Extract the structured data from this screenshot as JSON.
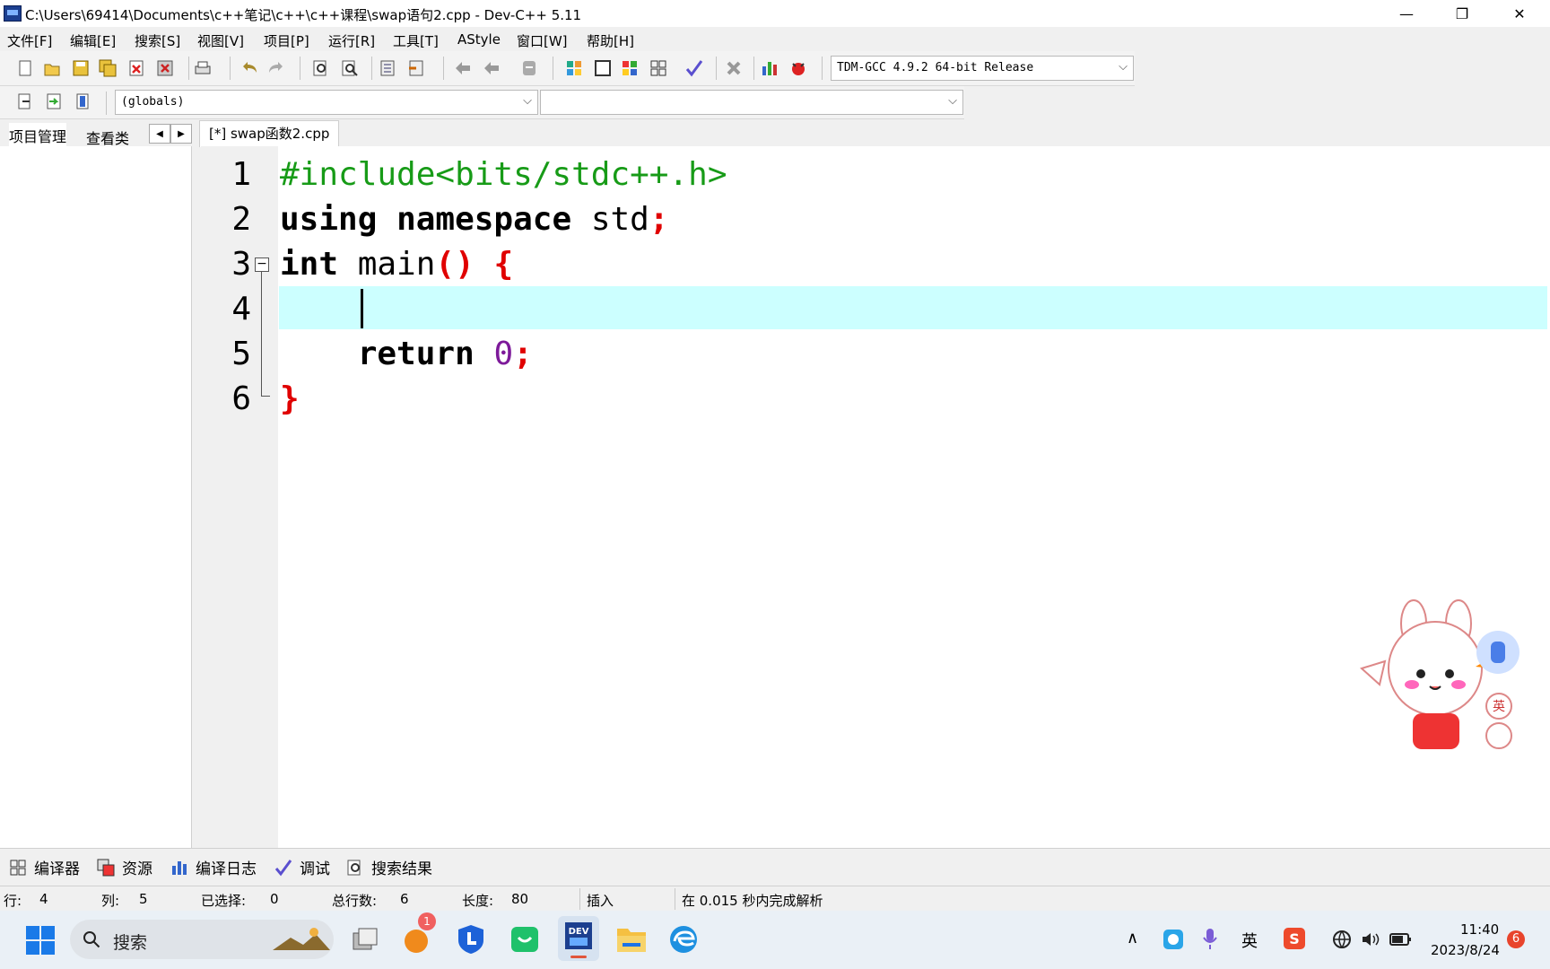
{
  "window": {
    "title": "C:\\Users\\69414\\Documents\\c++笔记\\c++\\c++课程\\swap语句2.cpp - Dev-C++ 5.11",
    "minimize": "—",
    "maximize": "❐",
    "close": "✕"
  },
  "menu": [
    "文件[F]",
    "编辑[E]",
    "搜索[S]",
    "视图[V]",
    "项目[P]",
    "运行[R]",
    "工具[T]",
    "AStyle",
    "窗口[W]",
    "帮助[H]"
  ],
  "toolbar": {
    "compiler_select": "TDM-GCC 4.9.2 64-bit Release",
    "scope_select": "(globals)",
    "function_select": ""
  },
  "left_tabs": {
    "project": "项目管理",
    "classes": "查看类"
  },
  "file_tab": "[*] swap函数2.cpp",
  "editor": {
    "line_numbers": [
      "1",
      "2",
      "3",
      "4",
      "5",
      "6"
    ],
    "lines": [
      [
        {
          "t": "#include<bits/stdc++.h>",
          "c": "pp"
        }
      ],
      [
        {
          "t": "using",
          "c": "kw"
        },
        {
          "t": " ",
          "c": ""
        },
        {
          "t": "namespace",
          "c": "kw"
        },
        {
          "t": " std",
          "c": ""
        },
        {
          "t": ";",
          "c": "sym"
        }
      ],
      [
        {
          "t": "int",
          "c": "kw"
        },
        {
          "t": " main",
          "c": ""
        },
        {
          "t": "()",
          "c": "sym"
        },
        {
          "t": " ",
          "c": ""
        },
        {
          "t": "{",
          "c": "sym"
        }
      ],
      [
        {
          "t": "    ",
          "c": ""
        }
      ],
      [
        {
          "t": "    ",
          "c": ""
        },
        {
          "t": "return",
          "c": "kw"
        },
        {
          "t": " ",
          "c": ""
        },
        {
          "t": "0",
          "c": "num"
        },
        {
          "t": ";",
          "c": "sym"
        }
      ],
      [
        {
          "t": "}",
          "c": "sym"
        }
      ]
    ],
    "current_line": 4
  },
  "bottom_tabs": [
    "编译器",
    "资源",
    "编译日志",
    "调试",
    "搜索结果"
  ],
  "status": {
    "row_label": "行:",
    "row": "4",
    "col_label": "列:",
    "col": "5",
    "sel_label": "已选择:",
    "sel": "0",
    "total_label": "总行数:",
    "total": "6",
    "len_label": "长度:",
    "len": "80",
    "mode": "插入",
    "message": "在 0.015 秒内完成解析"
  },
  "taskbar": {
    "search_placeholder": "搜索",
    "notification_count": "1",
    "ime_lang": "英",
    "time": "11:40",
    "date": "2023/8/24",
    "notif_badge": "6"
  },
  "mascot": {
    "badge_text": "英"
  },
  "colors": {
    "current_line": "#ccffff",
    "preprocessor": "#179b17",
    "symbol": "#e00000",
    "number": "#7d1a9a"
  }
}
